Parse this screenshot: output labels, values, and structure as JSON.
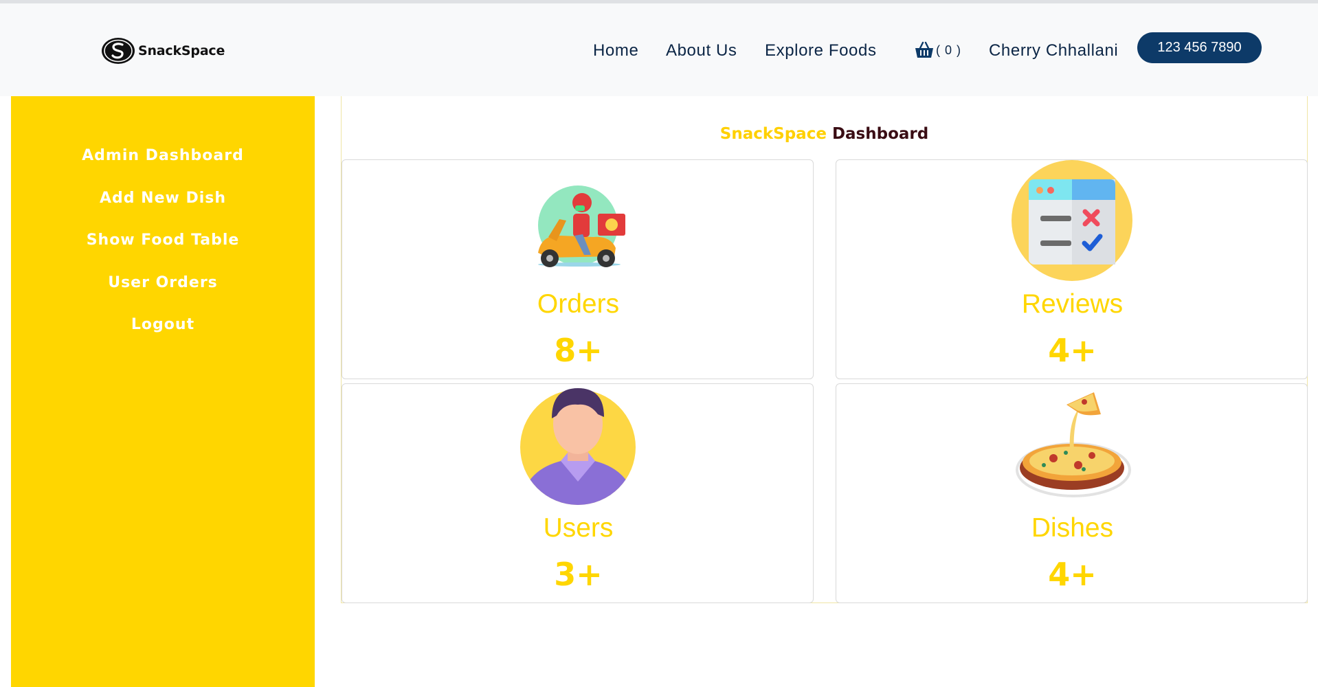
{
  "header": {
    "brand": "SnackSpace",
    "nav": {
      "home": "Home",
      "about": "About Us",
      "explore": "Explore Foods"
    },
    "cart_count": "( 0 )",
    "user_name": "Cherry Chhallani",
    "phone": "123 456 7890"
  },
  "sidebar": {
    "items": [
      {
        "label": "Admin Dashboard"
      },
      {
        "label": "Add New Dish"
      },
      {
        "label": "Show Food Table"
      },
      {
        "label": "User Orders"
      },
      {
        "label": "Logout"
      }
    ]
  },
  "dashboard": {
    "title_brand": "SnackSpace",
    "title_rest": " Dashboard",
    "cards": [
      {
        "label": "Orders",
        "value": "8+",
        "icon": "delivery-scooter-icon"
      },
      {
        "label": "Reviews",
        "value": "4+",
        "icon": "review-checklist-icon"
      },
      {
        "label": "Users",
        "value": "3+",
        "icon": "user-avatar-icon"
      },
      {
        "label": "Dishes",
        "value": "4+",
        "icon": "pizza-icon"
      }
    ]
  },
  "colors": {
    "accent_yellow": "#ffd600",
    "navy": "#0d3a68",
    "title_dark": "#3a0d14"
  }
}
